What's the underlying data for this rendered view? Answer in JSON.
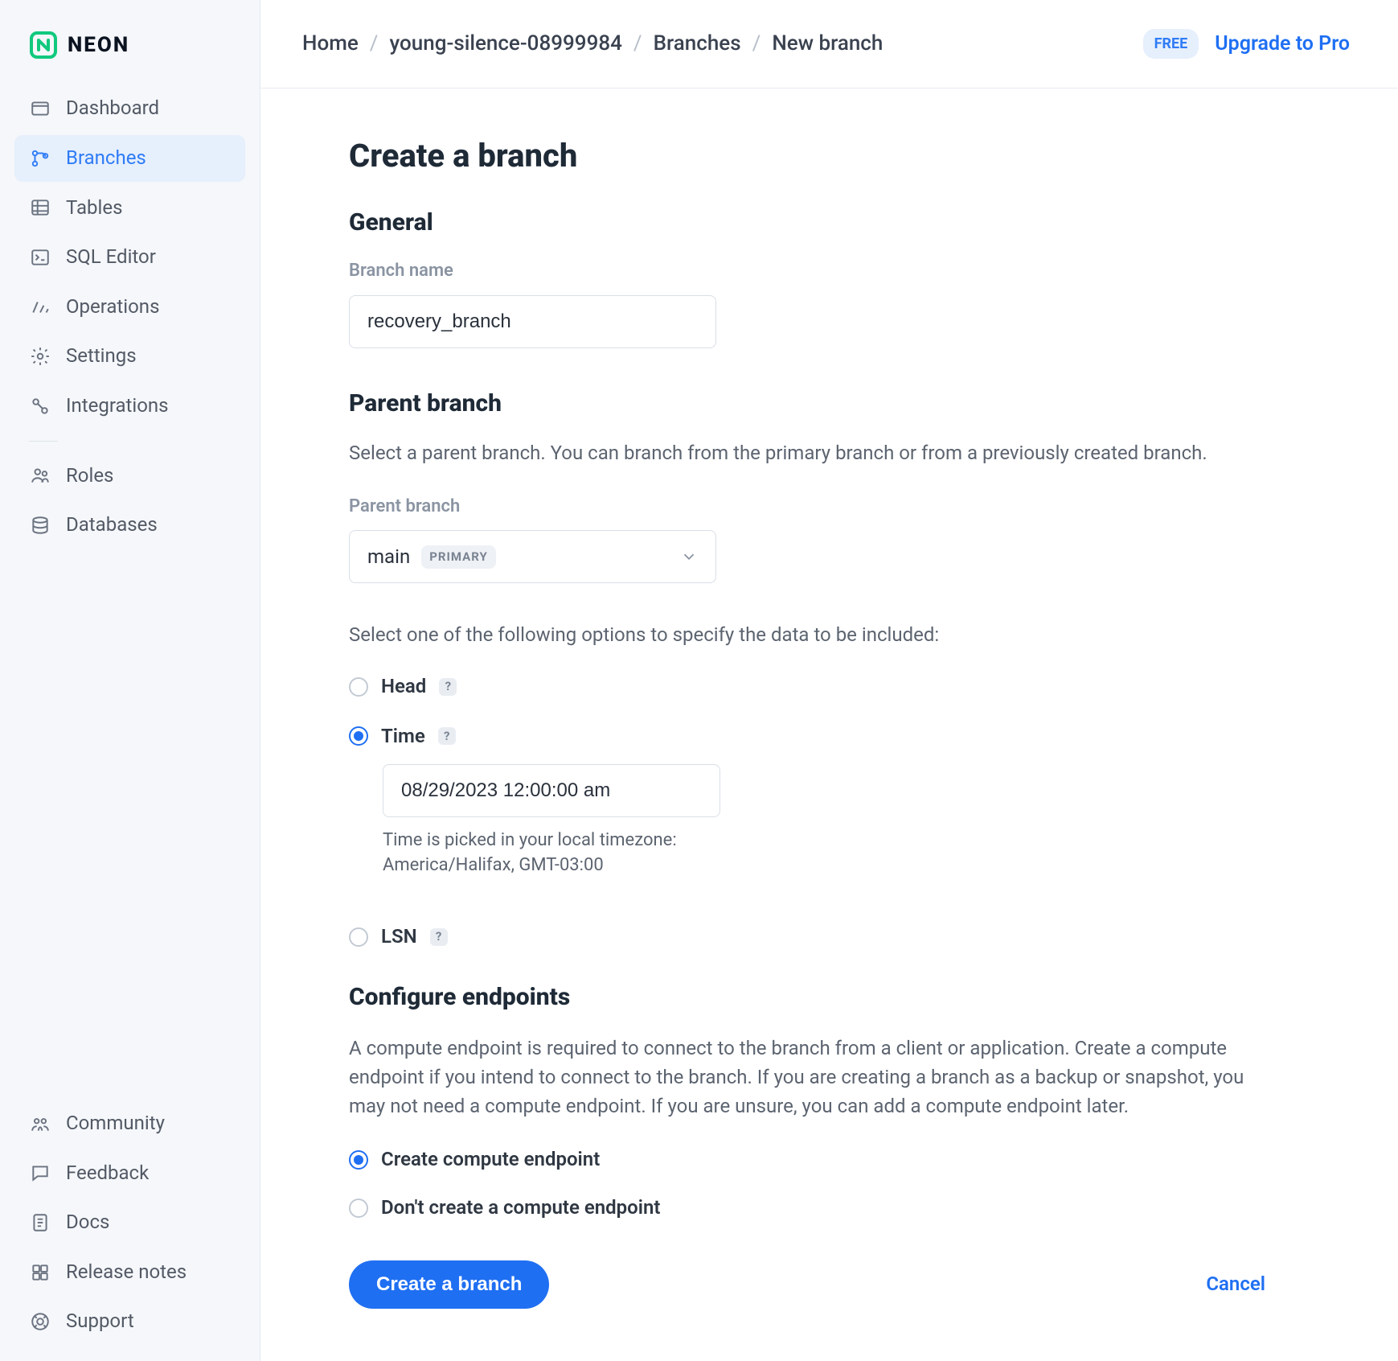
{
  "brand": {
    "name": "NEON"
  },
  "sidebar": {
    "main": [
      {
        "label": "Dashboard",
        "icon": "dashboard-icon"
      },
      {
        "label": "Branches",
        "icon": "branches-icon",
        "active": true
      },
      {
        "label": "Tables",
        "icon": "tables-icon"
      },
      {
        "label": "SQL Editor",
        "icon": "sql-editor-icon"
      },
      {
        "label": "Operations",
        "icon": "operations-icon"
      },
      {
        "label": "Settings",
        "icon": "settings-icon"
      },
      {
        "label": "Integrations",
        "icon": "integrations-icon"
      }
    ],
    "secondary": [
      {
        "label": "Roles",
        "icon": "roles-icon"
      },
      {
        "label": "Databases",
        "icon": "databases-icon"
      }
    ],
    "footer": [
      {
        "label": "Community",
        "icon": "community-icon"
      },
      {
        "label": "Feedback",
        "icon": "feedback-icon"
      },
      {
        "label": "Docs",
        "icon": "docs-icon"
      },
      {
        "label": "Release notes",
        "icon": "release-notes-icon"
      },
      {
        "label": "Support",
        "icon": "support-icon"
      }
    ]
  },
  "topbar": {
    "breadcrumb": [
      "Home",
      "young-silence-08999984",
      "Branches",
      "New branch"
    ],
    "free_badge": "FREE",
    "upgrade": "Upgrade to Pro"
  },
  "page": {
    "title": "Create a branch",
    "general": {
      "heading": "General",
      "branch_name_label": "Branch name",
      "branch_name_value": "recovery_branch"
    },
    "parent": {
      "heading": "Parent branch",
      "description": "Select a parent branch. You can branch from the primary branch or from a previously created branch.",
      "label": "Parent branch",
      "selected": "main",
      "tag": "PRIMARY",
      "options_note": "Select one of the following options to specify the data to be included:",
      "radios": {
        "head": "Head",
        "time": "Time",
        "lsn": "LSN",
        "selected": "time"
      },
      "time_value": "08/29/2023 12:00:00 am",
      "tz_note": "Time is picked in your local timezone: America/Halifax, GMT-03:00"
    },
    "endpoints": {
      "heading": "Configure endpoints",
      "description": "A compute endpoint is required to connect to the branch from a client or application. Create a compute endpoint if you intend to connect to the branch. If you are creating a branch as a backup or snapshot, you may not need a compute endpoint. If you are unsure, you can add a compute endpoint later.",
      "create_label": "Create compute endpoint",
      "dont_create_label": "Don't create a compute endpoint",
      "selected": "create"
    },
    "actions": {
      "submit": "Create a branch",
      "cancel": "Cancel"
    }
  }
}
